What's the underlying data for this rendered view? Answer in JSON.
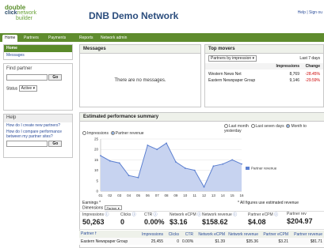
{
  "header": {
    "logo_line1_a": "double",
    "logo_line1_b": "click",
    "logo_line2": "network",
    "logo_line3": "builder",
    "title": "DNB Demo Network",
    "links": "Help | Sign ou"
  },
  "nav": {
    "tabs": [
      "Home",
      "Partners",
      "Payments",
      "Reports",
      "Network admin"
    ]
  },
  "sidebar": {
    "home": "Home",
    "messages": "Messages",
    "find_partner": "Find partner",
    "go": "Go",
    "status_label": "Status",
    "status_value": "Active",
    "help_title": "Help",
    "help_q1": "How do I create new partners?",
    "help_q2": "How do I compare performance between my partner sites?",
    "go2": "Go"
  },
  "messages": {
    "title": "Messages",
    "empty": "There are no messages."
  },
  "top_movers": {
    "title": "Top movers",
    "filter": "Partners by impression",
    "range": "Last 7 days",
    "col_impressions": "Impressions",
    "col_change": "Change",
    "rows": [
      {
        "name": "Western News Net",
        "impressions": "8,769",
        "change": "-28.45%"
      },
      {
        "name": "Eastern Newspaper Group",
        "impressions": "9,146",
        "change": "-29.59%"
      }
    ]
  },
  "summary": {
    "title": "Estimated performance summary",
    "range_opts": [
      "Last month",
      "Last seven days",
      "Month to yesterday"
    ],
    "metric_opts": [
      "Impressions",
      "Partner revenue"
    ],
    "legend": "Partner revenue",
    "earnings_label": "Earnings *",
    "dimensions_label": "Dimensions",
    "dimensions_value": "Partner",
    "note": "* All figures use estimated revenue",
    "stats": [
      {
        "label": "Impressions",
        "value": "50,263"
      },
      {
        "label": "Clicks",
        "value": "0"
      },
      {
        "label": "CTR",
        "value": "0.00%"
      },
      {
        "label": "Network eCPM",
        "value": "$3.16"
      },
      {
        "label": "Network revenue",
        "value": "$158.62"
      },
      {
        "label": "Partner eCPM",
        "value": "$4.08"
      },
      {
        "label": "Partner rev",
        "value": "$204.97"
      }
    ]
  },
  "bottom_table": {
    "headers": [
      "Partner",
      "Impressions",
      "Clicks",
      "CTR",
      "Network eCPM",
      "Network revenue",
      "Partner eCPM",
      "Partner revenue"
    ],
    "rows": [
      [
        "Eastern Newspaper Group",
        "25,455",
        "0",
        "0.00%",
        "$1.39",
        "$35.36",
        "$3.21",
        "$81.71"
      ]
    ]
  },
  "chart_data": {
    "type": "area",
    "x": [
      "01",
      "02",
      "03",
      "04",
      "05",
      "06",
      "07",
      "08",
      "09",
      "10",
      "11",
      "12",
      "13",
      "14",
      "15",
      "16"
    ],
    "series": [
      {
        "name": "Partner revenue",
        "values": [
          17,
          14.5,
          13.5,
          7.5,
          6.5,
          22,
          20,
          23,
          14,
          11,
          10,
          2,
          12,
          13,
          15,
          13
        ]
      }
    ],
    "ylim": [
      0,
      25
    ],
    "yticks": [
      "0",
      "5",
      "10",
      "15",
      "20",
      "25"
    ],
    "color": "#5b7fd0"
  }
}
